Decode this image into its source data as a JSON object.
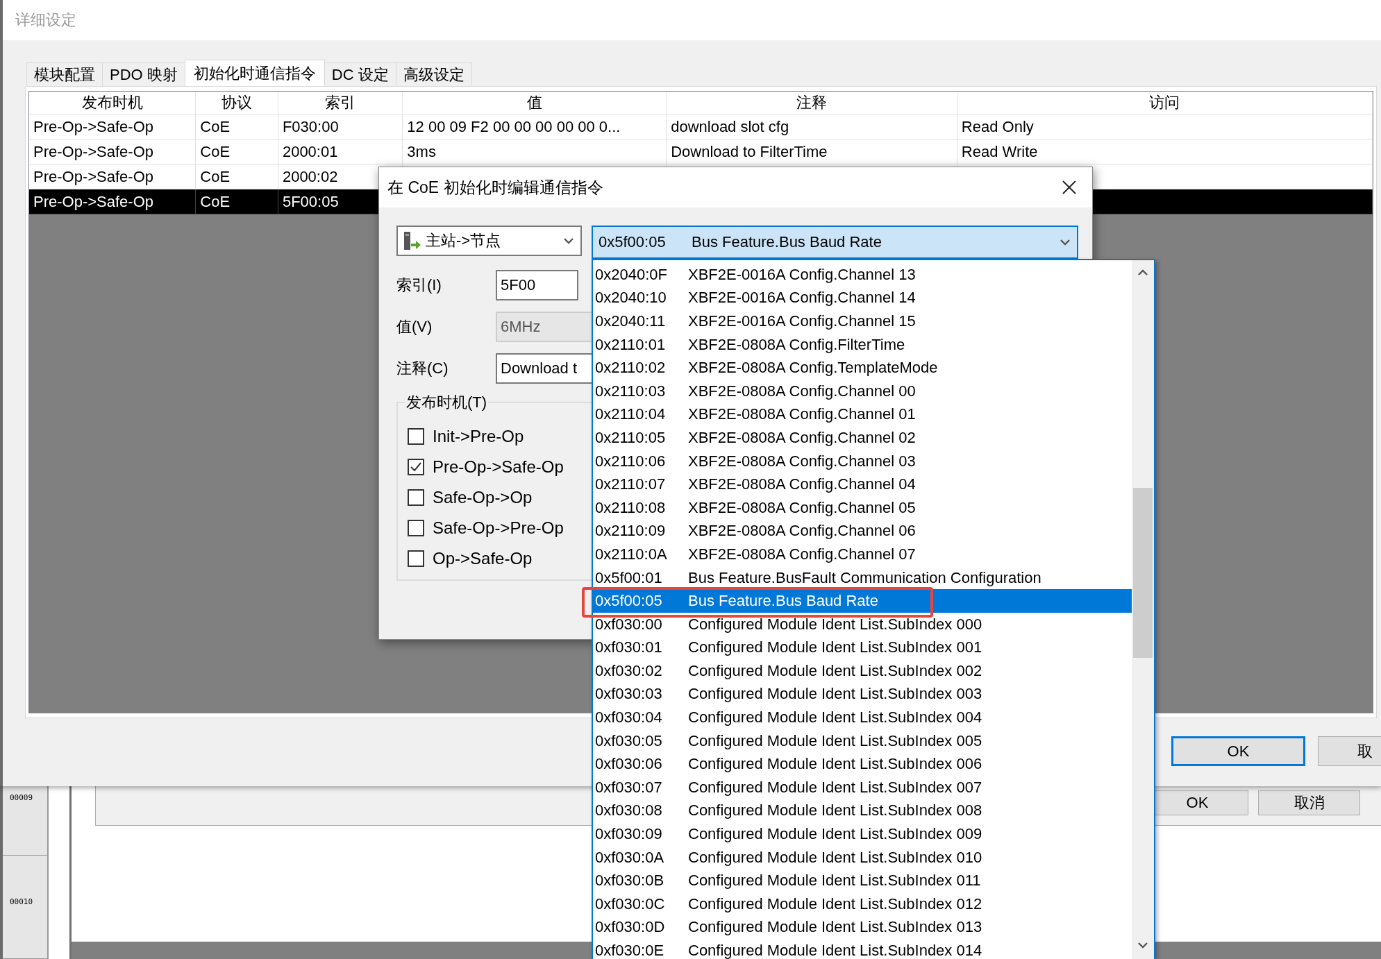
{
  "window": {
    "title": "详细设定"
  },
  "tabs": [
    {
      "label": "模块配置",
      "selected": false
    },
    {
      "label": "PDO 映射",
      "selected": false
    },
    {
      "label": "初始化时通信指令",
      "selected": true
    },
    {
      "label": "DC 设定",
      "selected": false
    },
    {
      "label": "高级设定",
      "selected": false
    }
  ],
  "table": {
    "columns": [
      "发布时机",
      "协议",
      "索引",
      "值",
      "注释",
      "访问"
    ],
    "rows": [
      {
        "cells": [
          "Pre-Op->Safe-Op",
          "CoE",
          "F030:00",
          "12 00 09 F2 00 00 00 00 00 0...",
          "download slot cfg",
          "Read Only"
        ],
        "selected": false
      },
      {
        "cells": [
          "Pre-Op->Safe-Op",
          "CoE",
          "2000:01",
          "3ms",
          "Download to FilterTime",
          "Read Write"
        ],
        "selected": false
      },
      {
        "cells": [
          "Pre-Op->Safe-Op",
          "CoE",
          "2000:02"
        ],
        "selected": false
      },
      {
        "cells": [
          "Pre-Op->Safe-Op",
          "CoE",
          "5F00:05"
        ],
        "selected": true
      }
    ]
  },
  "buttons": [
    {
      "label": "OK",
      "default": true
    },
    {
      "label": "取",
      "default": false
    }
  ],
  "background_window": {
    "row_numbers": [
      "00009",
      "00010"
    ],
    "buttons": [
      {
        "label": "OK"
      },
      {
        "label": "取消"
      }
    ]
  },
  "dialog": {
    "title": "在 CoE 初始化时编辑通信指令",
    "direction": {
      "value": "主站->节点"
    },
    "index_combo": {
      "code": "0x5f00:05",
      "name": "Bus Feature.Bus Baud Rate"
    },
    "fields": [
      {
        "label": "索引(I)",
        "value": "5F00",
        "disabled": false
      },
      {
        "label": "值(V)",
        "value": "6MHz",
        "disabled": true
      },
      {
        "label": "注释(C)",
        "value": "Download t",
        "disabled": false
      }
    ],
    "group": {
      "title": "发布时机(T)",
      "options": [
        {
          "label": "Init->Pre-Op",
          "checked": false
        },
        {
          "label": "Pre-Op->Safe-Op",
          "checked": true
        },
        {
          "label": "Safe-Op->Op",
          "checked": false
        },
        {
          "label": "Safe-Op->Pre-Op",
          "checked": false
        },
        {
          "label": "Op->Safe-Op",
          "checked": false
        }
      ]
    }
  },
  "dropdown": {
    "items": [
      {
        "code": "0x2040:0F",
        "name": "XBF2E-0016A Config.Channel 13",
        "selected": false
      },
      {
        "code": "0x2040:10",
        "name": "XBF2E-0016A Config.Channel 14",
        "selected": false
      },
      {
        "code": "0x2040:11",
        "name": "XBF2E-0016A Config.Channel 15",
        "selected": false
      },
      {
        "code": "0x2110:01",
        "name": "XBF2E-0808A Config.FilterTime",
        "selected": false
      },
      {
        "code": "0x2110:02",
        "name": "XBF2E-0808A Config.TemplateMode",
        "selected": false
      },
      {
        "code": "0x2110:03",
        "name": "XBF2E-0808A Config.Channel 00",
        "selected": false
      },
      {
        "code": "0x2110:04",
        "name": "XBF2E-0808A Config.Channel 01",
        "selected": false
      },
      {
        "code": "0x2110:05",
        "name": "XBF2E-0808A Config.Channel 02",
        "selected": false
      },
      {
        "code": "0x2110:06",
        "name": "XBF2E-0808A Config.Channel 03",
        "selected": false
      },
      {
        "code": "0x2110:07",
        "name": "XBF2E-0808A Config.Channel 04",
        "selected": false
      },
      {
        "code": "0x2110:08",
        "name": "XBF2E-0808A Config.Channel 05",
        "selected": false
      },
      {
        "code": "0x2110:09",
        "name": "XBF2E-0808A Config.Channel 06",
        "selected": false
      },
      {
        "code": "0x2110:0A",
        "name": "XBF2E-0808A Config.Channel 07",
        "selected": false
      },
      {
        "code": "0x5f00:01",
        "name": "Bus Feature.BusFault Communication Configuration",
        "selected": false
      },
      {
        "code": "0x5f00:05",
        "name": "Bus Feature.Bus Baud Rate",
        "selected": true
      },
      {
        "code": "0xf030:00",
        "name": "Configured Module Ident List.SubIndex 000",
        "selected": false
      },
      {
        "code": "0xf030:01",
        "name": "Configured Module Ident List.SubIndex 001",
        "selected": false
      },
      {
        "code": "0xf030:02",
        "name": "Configured Module Ident List.SubIndex 002",
        "selected": false
      },
      {
        "code": "0xf030:03",
        "name": "Configured Module Ident List.SubIndex 003",
        "selected": false
      },
      {
        "code": "0xf030:04",
        "name": "Configured Module Ident List.SubIndex 004",
        "selected": false
      },
      {
        "code": "0xf030:05",
        "name": "Configured Module Ident List.SubIndex 005",
        "selected": false
      },
      {
        "code": "0xf030:06",
        "name": "Configured Module Ident List.SubIndex 006",
        "selected": false
      },
      {
        "code": "0xf030:07",
        "name": "Configured Module Ident List.SubIndex 007",
        "selected": false
      },
      {
        "code": "0xf030:08",
        "name": "Configured Module Ident List.SubIndex 008",
        "selected": false
      },
      {
        "code": "0xf030:09",
        "name": "Configured Module Ident List.SubIndex 009",
        "selected": false
      },
      {
        "code": "0xf030:0A",
        "name": "Configured Module Ident List.SubIndex 010",
        "selected": false
      },
      {
        "code": "0xf030:0B",
        "name": "Configured Module Ident List.SubIndex 011",
        "selected": false
      },
      {
        "code": "0xf030:0C",
        "name": "Configured Module Ident List.SubIndex 012",
        "selected": false
      },
      {
        "code": "0xf030:0D",
        "name": "Configured Module Ident List.SubIndex 013",
        "selected": false
      },
      {
        "code": "0xf030:0E",
        "name": "Configured Module Ident List.SubIndex 014",
        "selected": false
      }
    ]
  }
}
